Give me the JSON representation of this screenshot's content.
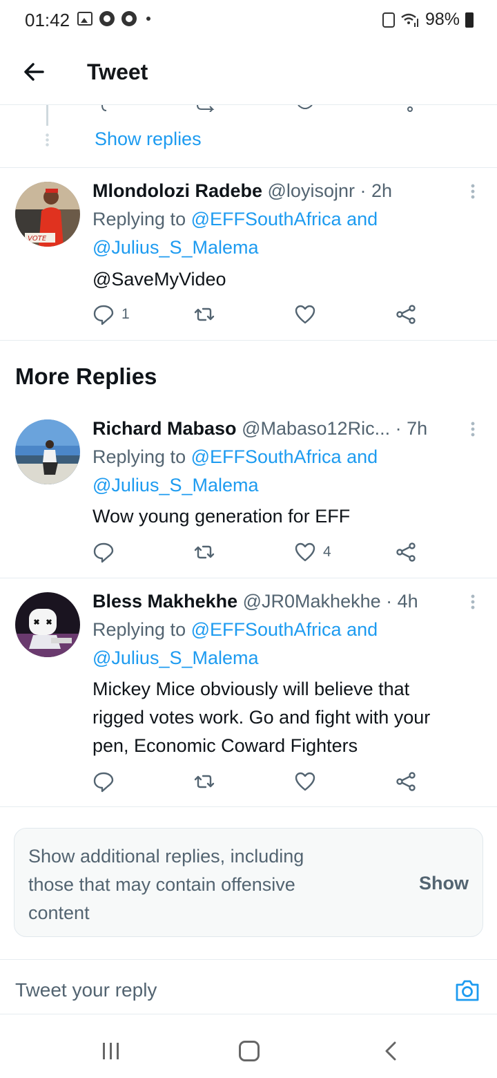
{
  "status_bar": {
    "time": "01:42",
    "battery": "98%"
  },
  "header": {
    "title": "Tweet"
  },
  "thread": {
    "show_replies": "Show replies"
  },
  "tweets": [
    {
      "name": "Mlondolozi Radebe",
      "handle_time": "@loyisojnr · 2h",
      "replying_prefix": "Replying to ",
      "replying_to_1": "@EFFSouthAfrica and",
      "replying_to_2": "@Julius_S_Malema",
      "text": "@SaveMyVideo",
      "reply_count": "1",
      "retweet_count": "",
      "like_count": "",
      "avatar_label": "VOTE"
    },
    {
      "name": "Richard Mabaso",
      "handle_time": "@Mabaso12Ric... · 7h",
      "replying_prefix": "Replying to ",
      "replying_to_1": "@EFFSouthAfrica and",
      "replying_to_2": "@Julius_S_Malema",
      "text": "Wow young generation for EFF",
      "reply_count": "",
      "retweet_count": "",
      "like_count": "4"
    },
    {
      "name": "Bless Makhekhe",
      "handle_time": "@JR0Makhekhe · 4h",
      "replying_prefix": "Replying to ",
      "replying_to_1": "@EFFSouthAfrica and",
      "replying_to_2": "@Julius_S_Malema",
      "text_lines": [
        "Mickey Mice obviously will believe that",
        "rigged votes work. Go and fight with your",
        "pen, Economic Coward Fighters"
      ],
      "reply_count": "",
      "retweet_count": "",
      "like_count": ""
    }
  ],
  "section": {
    "more_replies": "More Replies"
  },
  "additional_replies": {
    "lines": [
      "Show additional replies, including",
      "those that may contain offensive",
      "content"
    ],
    "show_label": "Show"
  },
  "composer": {
    "placeholder": "Tweet your reply"
  },
  "colors": {
    "link": "#1d9bf0",
    "secondary": "#536471",
    "text": "#0f1419"
  }
}
